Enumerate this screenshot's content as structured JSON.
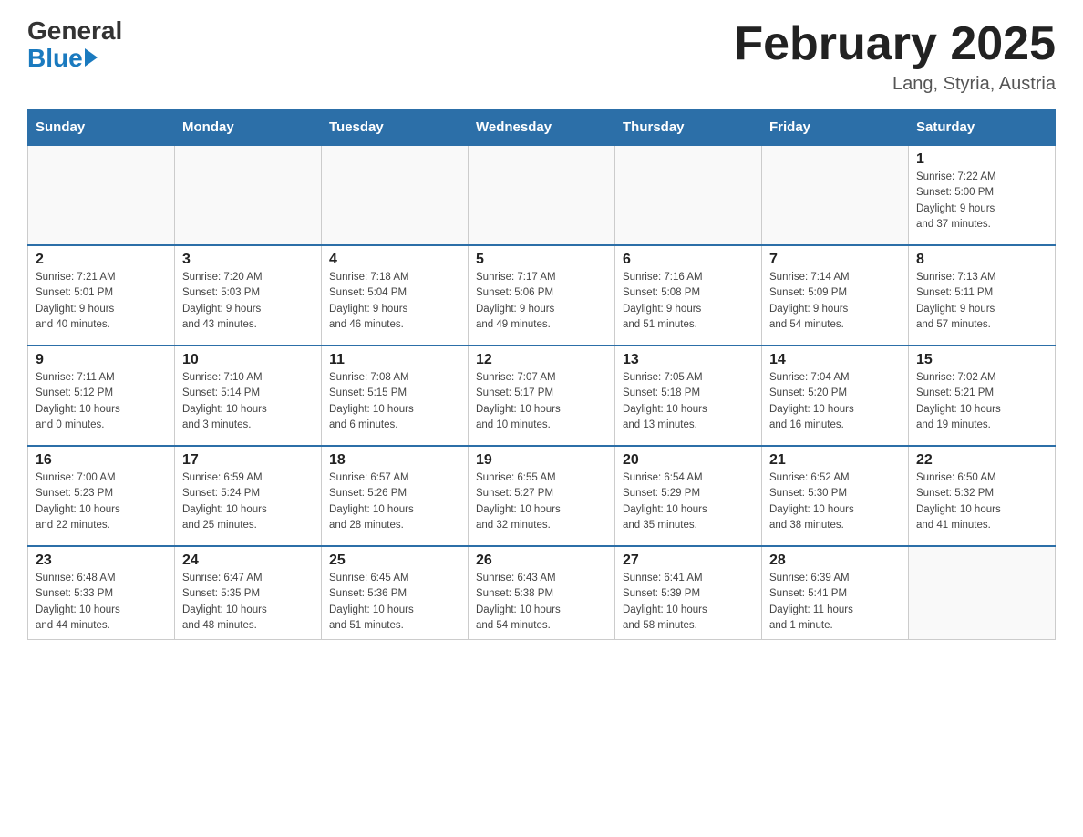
{
  "header": {
    "logo_general": "General",
    "logo_blue": "Blue",
    "title": "February 2025",
    "subtitle": "Lang, Styria, Austria"
  },
  "weekdays": [
    "Sunday",
    "Monday",
    "Tuesday",
    "Wednesday",
    "Thursday",
    "Friday",
    "Saturday"
  ],
  "weeks": [
    [
      {
        "day": "",
        "info": ""
      },
      {
        "day": "",
        "info": ""
      },
      {
        "day": "",
        "info": ""
      },
      {
        "day": "",
        "info": ""
      },
      {
        "day": "",
        "info": ""
      },
      {
        "day": "",
        "info": ""
      },
      {
        "day": "1",
        "info": "Sunrise: 7:22 AM\nSunset: 5:00 PM\nDaylight: 9 hours\nand 37 minutes."
      }
    ],
    [
      {
        "day": "2",
        "info": "Sunrise: 7:21 AM\nSunset: 5:01 PM\nDaylight: 9 hours\nand 40 minutes."
      },
      {
        "day": "3",
        "info": "Sunrise: 7:20 AM\nSunset: 5:03 PM\nDaylight: 9 hours\nand 43 minutes."
      },
      {
        "day": "4",
        "info": "Sunrise: 7:18 AM\nSunset: 5:04 PM\nDaylight: 9 hours\nand 46 minutes."
      },
      {
        "day": "5",
        "info": "Sunrise: 7:17 AM\nSunset: 5:06 PM\nDaylight: 9 hours\nand 49 minutes."
      },
      {
        "day": "6",
        "info": "Sunrise: 7:16 AM\nSunset: 5:08 PM\nDaylight: 9 hours\nand 51 minutes."
      },
      {
        "day": "7",
        "info": "Sunrise: 7:14 AM\nSunset: 5:09 PM\nDaylight: 9 hours\nand 54 minutes."
      },
      {
        "day": "8",
        "info": "Sunrise: 7:13 AM\nSunset: 5:11 PM\nDaylight: 9 hours\nand 57 minutes."
      }
    ],
    [
      {
        "day": "9",
        "info": "Sunrise: 7:11 AM\nSunset: 5:12 PM\nDaylight: 10 hours\nand 0 minutes."
      },
      {
        "day": "10",
        "info": "Sunrise: 7:10 AM\nSunset: 5:14 PM\nDaylight: 10 hours\nand 3 minutes."
      },
      {
        "day": "11",
        "info": "Sunrise: 7:08 AM\nSunset: 5:15 PM\nDaylight: 10 hours\nand 6 minutes."
      },
      {
        "day": "12",
        "info": "Sunrise: 7:07 AM\nSunset: 5:17 PM\nDaylight: 10 hours\nand 10 minutes."
      },
      {
        "day": "13",
        "info": "Sunrise: 7:05 AM\nSunset: 5:18 PM\nDaylight: 10 hours\nand 13 minutes."
      },
      {
        "day": "14",
        "info": "Sunrise: 7:04 AM\nSunset: 5:20 PM\nDaylight: 10 hours\nand 16 minutes."
      },
      {
        "day": "15",
        "info": "Sunrise: 7:02 AM\nSunset: 5:21 PM\nDaylight: 10 hours\nand 19 minutes."
      }
    ],
    [
      {
        "day": "16",
        "info": "Sunrise: 7:00 AM\nSunset: 5:23 PM\nDaylight: 10 hours\nand 22 minutes."
      },
      {
        "day": "17",
        "info": "Sunrise: 6:59 AM\nSunset: 5:24 PM\nDaylight: 10 hours\nand 25 minutes."
      },
      {
        "day": "18",
        "info": "Sunrise: 6:57 AM\nSunset: 5:26 PM\nDaylight: 10 hours\nand 28 minutes."
      },
      {
        "day": "19",
        "info": "Sunrise: 6:55 AM\nSunset: 5:27 PM\nDaylight: 10 hours\nand 32 minutes."
      },
      {
        "day": "20",
        "info": "Sunrise: 6:54 AM\nSunset: 5:29 PM\nDaylight: 10 hours\nand 35 minutes."
      },
      {
        "day": "21",
        "info": "Sunrise: 6:52 AM\nSunset: 5:30 PM\nDaylight: 10 hours\nand 38 minutes."
      },
      {
        "day": "22",
        "info": "Sunrise: 6:50 AM\nSunset: 5:32 PM\nDaylight: 10 hours\nand 41 minutes."
      }
    ],
    [
      {
        "day": "23",
        "info": "Sunrise: 6:48 AM\nSunset: 5:33 PM\nDaylight: 10 hours\nand 44 minutes."
      },
      {
        "day": "24",
        "info": "Sunrise: 6:47 AM\nSunset: 5:35 PM\nDaylight: 10 hours\nand 48 minutes."
      },
      {
        "day": "25",
        "info": "Sunrise: 6:45 AM\nSunset: 5:36 PM\nDaylight: 10 hours\nand 51 minutes."
      },
      {
        "day": "26",
        "info": "Sunrise: 6:43 AM\nSunset: 5:38 PM\nDaylight: 10 hours\nand 54 minutes."
      },
      {
        "day": "27",
        "info": "Sunrise: 6:41 AM\nSunset: 5:39 PM\nDaylight: 10 hours\nand 58 minutes."
      },
      {
        "day": "28",
        "info": "Sunrise: 6:39 AM\nSunset: 5:41 PM\nDaylight: 11 hours\nand 1 minute."
      },
      {
        "day": "",
        "info": ""
      }
    ]
  ]
}
